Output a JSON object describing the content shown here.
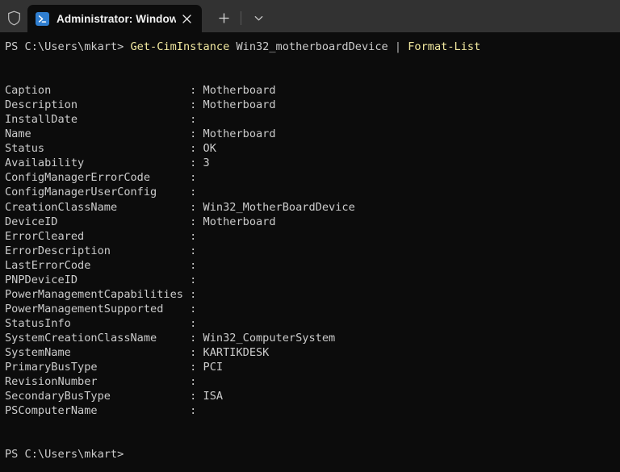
{
  "window": {
    "titlebar": {
      "admin_shield_icon": "shield-icon",
      "tab": {
        "icon": "powershell-icon",
        "title": "Administrator: Windows Powe",
        "close_icon": "close-icon"
      },
      "new_tab_icon": "plus-icon",
      "dropdown_icon": "chevron-down-icon"
    }
  },
  "terminal": {
    "colors": {
      "background": "#0c0c0c",
      "foreground": "#cccccc",
      "command": "#f2e9a0",
      "pipe": "#b4b4b4",
      "titlebar": "#323232"
    },
    "prompt": "PS C:\\Users\\mkart>",
    "command": {
      "cmdlet": "Get-CimInstance",
      "argument": "Win32_motherboardDevice",
      "pipe": "|",
      "format_cmdlet": "Format-List"
    },
    "label_width": 28,
    "properties": [
      {
        "name": "Caption",
        "value": "Motherboard"
      },
      {
        "name": "Description",
        "value": "Motherboard"
      },
      {
        "name": "InstallDate",
        "value": ""
      },
      {
        "name": "Name",
        "value": "Motherboard"
      },
      {
        "name": "Status",
        "value": "OK"
      },
      {
        "name": "Availability",
        "value": "3"
      },
      {
        "name": "ConfigManagerErrorCode",
        "value": ""
      },
      {
        "name": "ConfigManagerUserConfig",
        "value": ""
      },
      {
        "name": "CreationClassName",
        "value": "Win32_MotherBoardDevice"
      },
      {
        "name": "DeviceID",
        "value": "Motherboard"
      },
      {
        "name": "ErrorCleared",
        "value": ""
      },
      {
        "name": "ErrorDescription",
        "value": ""
      },
      {
        "name": "LastErrorCode",
        "value": ""
      },
      {
        "name": "PNPDeviceID",
        "value": ""
      },
      {
        "name": "PowerManagementCapabilities",
        "value": ""
      },
      {
        "name": "PowerManagementSupported",
        "value": ""
      },
      {
        "name": "StatusInfo",
        "value": ""
      },
      {
        "name": "SystemCreationClassName",
        "value": "Win32_ComputerSystem"
      },
      {
        "name": "SystemName",
        "value": "KARTIKDESK"
      },
      {
        "name": "PrimaryBusType",
        "value": "PCI"
      },
      {
        "name": "RevisionNumber",
        "value": ""
      },
      {
        "name": "SecondaryBusType",
        "value": "ISA"
      },
      {
        "name": "PSComputerName",
        "value": ""
      }
    ],
    "final_prompt": "PS C:\\Users\\mkart>"
  }
}
